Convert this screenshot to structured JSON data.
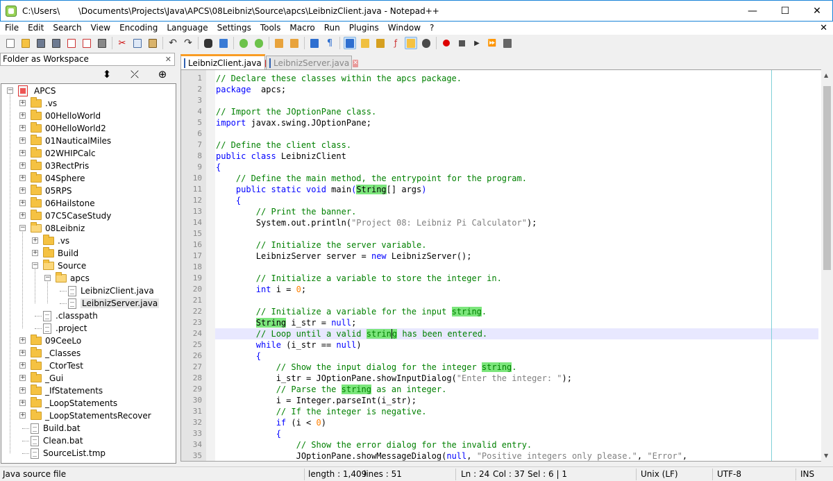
{
  "window": {
    "title": "C:\\Users\\       \\Documents\\Projects\\Java\\APCS\\08Leibniz\\Source\\apcs\\LeibnizClient.java - Notepad++",
    "minimize": "—",
    "maximize": "☐",
    "close": "✕"
  },
  "menu": [
    "File",
    "Edit",
    "Search",
    "View",
    "Encoding",
    "Language",
    "Settings",
    "Tools",
    "Macro",
    "Run",
    "Plugins",
    "Window",
    "?"
  ],
  "menu_close": "✕",
  "panel": {
    "title": "Folder as Workspace",
    "close": "✕",
    "tools": [
      "⬍",
      "⤫",
      "⊕"
    ]
  },
  "tree": [
    {
      "label": "APCS",
      "type": "root",
      "expander": "−"
    },
    {
      "label": ".vs",
      "type": "folder",
      "expander": "+"
    },
    {
      "label": "00HelloWorld",
      "type": "folder",
      "expander": "+"
    },
    {
      "label": "00HelloWorld2",
      "type": "folder",
      "expander": "+"
    },
    {
      "label": "01NauticalMiles",
      "type": "folder",
      "expander": "+"
    },
    {
      "label": "02WHIPCalc",
      "type": "folder",
      "expander": "+"
    },
    {
      "label": "03RectPris",
      "type": "folder",
      "expander": "+"
    },
    {
      "label": "04Sphere",
      "type": "folder",
      "expander": "+"
    },
    {
      "label": "05RPS",
      "type": "folder",
      "expander": "+"
    },
    {
      "label": "06Hailstone",
      "type": "folder",
      "expander": "+"
    },
    {
      "label": "07C5CaseStudy",
      "type": "folder",
      "expander": "+"
    },
    {
      "label": "08Leibniz",
      "type": "folder-open",
      "expander": "−"
    },
    {
      "label": ".vs",
      "type": "folder",
      "expander": "+"
    },
    {
      "label": "Build",
      "type": "folder",
      "expander": "+"
    },
    {
      "label": "Source",
      "type": "folder-open",
      "expander": "−"
    },
    {
      "label": "apcs",
      "type": "folder-open",
      "expander": "−"
    },
    {
      "label": "LeibnizClient.java",
      "type": "file"
    },
    {
      "label": "LeibnizServer.java",
      "type": "file",
      "selected": true
    },
    {
      "label": ".classpath",
      "type": "file"
    },
    {
      "label": ".project",
      "type": "file"
    },
    {
      "label": "09CeeLo",
      "type": "folder",
      "expander": "+"
    },
    {
      "label": "_Classes",
      "type": "folder",
      "expander": "+"
    },
    {
      "label": "_CtorTest",
      "type": "folder",
      "expander": "+"
    },
    {
      "label": "_Gui",
      "type": "folder",
      "expander": "+"
    },
    {
      "label": "_IfStatements",
      "type": "folder",
      "expander": "+"
    },
    {
      "label": "_LoopStatements",
      "type": "folder",
      "expander": "+"
    },
    {
      "label": "_LoopStatementsRecover",
      "type": "folder",
      "expander": "+"
    },
    {
      "label": "Build.bat",
      "type": "file"
    },
    {
      "label": "Clean.bat",
      "type": "file"
    },
    {
      "label": "SourceList.tmp",
      "type": "file"
    }
  ],
  "tabs": [
    {
      "label": "LeibnizClient.java",
      "active": true,
      "close": "✕"
    },
    {
      "label": "LeibnizServer.java",
      "active": false,
      "close": "✕"
    }
  ],
  "code": [
    [
      [
        "c",
        "// Declare these classes within the apcs package."
      ]
    ],
    [
      [
        "k",
        "package"
      ],
      [
        "",
        "  apcs;"
      ]
    ],
    [],
    [
      [
        "c",
        "// Import the JOptionPane class."
      ]
    ],
    [
      [
        "k",
        "import"
      ],
      [
        "",
        " javax.swing.JOptionPane;"
      ]
    ],
    [],
    [
      [
        "c",
        "// Define the client class."
      ]
    ],
    [
      [
        "k",
        "public class"
      ],
      [
        "",
        " LeibnizClient"
      ]
    ],
    [
      [
        "k",
        "{"
      ]
    ],
    [
      [
        "",
        "    "
      ],
      [
        "c",
        "// Define the main method, the entrypoint for the program."
      ]
    ],
    [
      [
        "",
        "    "
      ],
      [
        "k",
        "public static void"
      ],
      [
        "",
        " main"
      ],
      [
        "k",
        "("
      ],
      [
        "h",
        "String"
      ],
      [
        "",
        "[] args"
      ],
      [
        "k",
        ")"
      ]
    ],
    [
      [
        "",
        "    "
      ],
      [
        "k",
        "{"
      ]
    ],
    [
      [
        "",
        "        "
      ],
      [
        "c",
        "// Print the banner."
      ]
    ],
    [
      [
        "",
        "        System.out.println("
      ],
      [
        "s",
        "\"Project 08: Leibniz Pi Calculator\""
      ],
      [
        "",
        ");"
      ]
    ],
    [],
    [
      [
        "",
        "        "
      ],
      [
        "c",
        "// Initialize the server variable."
      ]
    ],
    [
      [
        "",
        "        LeibnizServer server = "
      ],
      [
        "k",
        "new"
      ],
      [
        "",
        " LeibnizServer();"
      ]
    ],
    [],
    [
      [
        "",
        "        "
      ],
      [
        "c",
        "// Initialize a variable to store the integer in."
      ]
    ],
    [
      [
        "",
        "        "
      ],
      [
        "k",
        "int"
      ],
      [
        "",
        " i = "
      ],
      [
        "n",
        "0"
      ],
      [
        "",
        ";"
      ]
    ],
    [],
    [
      [
        "",
        "        "
      ],
      [
        "c",
        "// Initialize a variable for the input "
      ],
      [
        "ch",
        "string"
      ],
      [
        "c",
        "."
      ]
    ],
    [
      [
        "",
        "        "
      ],
      [
        "h",
        "String"
      ],
      [
        "",
        " i_str = "
      ],
      [
        "k",
        "null"
      ],
      [
        "",
        ";"
      ]
    ],
    [
      [
        "",
        "        "
      ],
      [
        "c",
        "// Loop until a valid "
      ],
      [
        "ch",
        "strin"
      ],
      [
        "chk",
        "g"
      ],
      [
        "c",
        " has been entered."
      ]
    ],
    [
      [
        "",
        "        "
      ],
      [
        "k",
        "while"
      ],
      [
        "",
        " (i_str == "
      ],
      [
        "k",
        "null"
      ],
      [
        "",
        ")"
      ]
    ],
    [
      [
        "",
        "        "
      ],
      [
        "k",
        "{"
      ]
    ],
    [
      [
        "",
        "            "
      ],
      [
        "c",
        "// Show the input dialog for the integer "
      ],
      [
        "ch",
        "string"
      ],
      [
        "c",
        "."
      ]
    ],
    [
      [
        "",
        "            i_str = JOptionPane.showInputDialog("
      ],
      [
        "s",
        "\"Enter the integer: \""
      ],
      [
        "",
        ");"
      ]
    ],
    [
      [
        "",
        "            "
      ],
      [
        "c",
        "// Parse the "
      ],
      [
        "ch",
        "string"
      ],
      [
        "c",
        " as an integer."
      ]
    ],
    [
      [
        "",
        "            i = Integer.parseInt(i_str);"
      ]
    ],
    [
      [
        "",
        "            "
      ],
      [
        "c",
        "// If the integer is negative."
      ]
    ],
    [
      [
        "",
        "            "
      ],
      [
        "k",
        "if"
      ],
      [
        "",
        " (i < "
      ],
      [
        "n",
        "0"
      ],
      [
        "",
        ")"
      ]
    ],
    [
      [
        "",
        "            "
      ],
      [
        "k",
        "{"
      ]
    ],
    [
      [
        "",
        "                "
      ],
      [
        "c",
        "// Show the error dialog for the invalid entry."
      ]
    ],
    [
      [
        "",
        "                JOptionPane.showMessageDialog("
      ],
      [
        "k",
        "null"
      ],
      [
        "",
        ", "
      ],
      [
        "s",
        "\"Positive integers only please.\""
      ],
      [
        "",
        ", "
      ],
      [
        "s",
        "\"Error\""
      ],
      [
        "",
        ","
      ]
    ]
  ],
  "status": {
    "type": "Java source file",
    "length": "length : 1,409",
    "lines": "lines : 51",
    "ln": "Ln : 24",
    "col": "Col : 37",
    "sel": "Sel : 6 | 1",
    "eol": "Unix (LF)",
    "enc": "UTF-8",
    "mode": "INS"
  }
}
